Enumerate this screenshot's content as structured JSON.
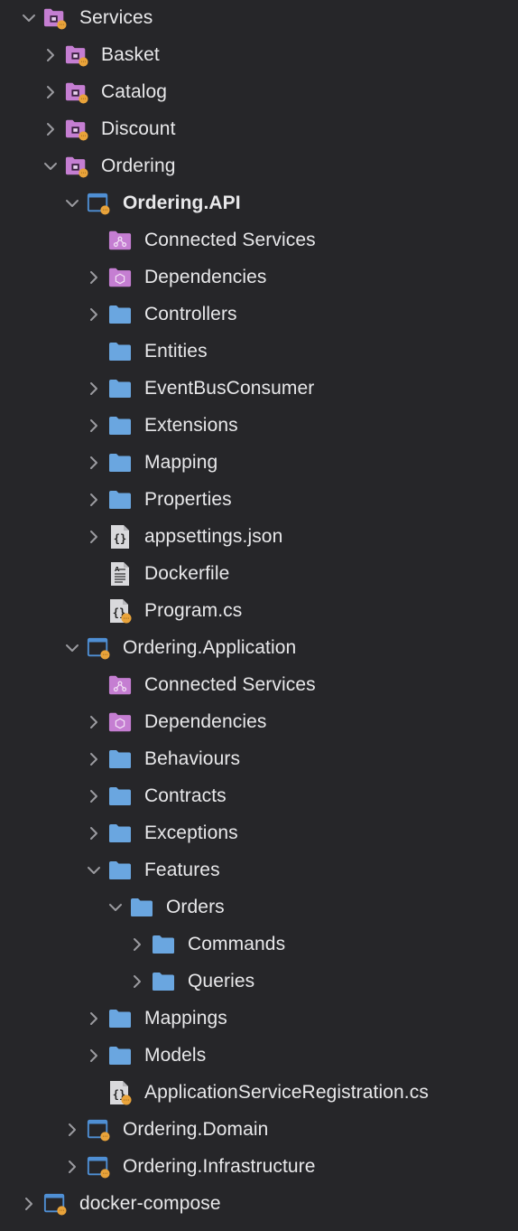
{
  "panel": "Solution Explorer",
  "nodes": [
    {
      "label": "Services",
      "depth": 0,
      "chevron": "down",
      "icon": "solution-folder-icon",
      "bold": false
    },
    {
      "label": "Basket",
      "depth": 1,
      "chevron": "right",
      "icon": "solution-folder-icon",
      "bold": false
    },
    {
      "label": "Catalog",
      "depth": 1,
      "chevron": "right",
      "icon": "solution-folder-icon",
      "bold": false
    },
    {
      "label": "Discount",
      "depth": 1,
      "chevron": "right",
      "icon": "solution-folder-icon",
      "bold": false
    },
    {
      "label": "Ordering",
      "depth": 1,
      "chevron": "down",
      "icon": "solution-folder-icon",
      "bold": false
    },
    {
      "label": "Ordering.API",
      "depth": 2,
      "chevron": "down",
      "icon": "project-icon",
      "bold": true
    },
    {
      "label": "Connected Services",
      "depth": 3,
      "chevron": "none",
      "icon": "connected-services-icon",
      "bold": false
    },
    {
      "label": "Dependencies",
      "depth": 3,
      "chevron": "right",
      "icon": "dependencies-icon",
      "bold": false
    },
    {
      "label": "Controllers",
      "depth": 3,
      "chevron": "right",
      "icon": "folder-icon",
      "bold": false
    },
    {
      "label": "Entities",
      "depth": 3,
      "chevron": "none",
      "icon": "folder-icon",
      "bold": false
    },
    {
      "label": "EventBusConsumer",
      "depth": 3,
      "chevron": "right",
      "icon": "folder-icon",
      "bold": false
    },
    {
      "label": "Extensions",
      "depth": 3,
      "chevron": "right",
      "icon": "folder-icon",
      "bold": false
    },
    {
      "label": "Mapping",
      "depth": 3,
      "chevron": "right",
      "icon": "folder-icon",
      "bold": false
    },
    {
      "label": "Properties",
      "depth": 3,
      "chevron": "right",
      "icon": "folder-icon",
      "bold": false
    },
    {
      "label": "appsettings.json",
      "depth": 3,
      "chevron": "right",
      "icon": "json-file-icon",
      "bold": false
    },
    {
      "label": "Dockerfile",
      "depth": 3,
      "chevron": "none",
      "icon": "text-file-icon",
      "bold": false
    },
    {
      "label": "Program.cs",
      "depth": 3,
      "chevron": "none",
      "icon": "csharp-file-icon",
      "bold": false
    },
    {
      "label": "Ordering.Application",
      "depth": 2,
      "chevron": "down",
      "icon": "project-icon",
      "bold": false
    },
    {
      "label": "Connected Services",
      "depth": 3,
      "chevron": "none",
      "icon": "connected-services-icon",
      "bold": false
    },
    {
      "label": "Dependencies",
      "depth": 3,
      "chevron": "right",
      "icon": "dependencies-icon",
      "bold": false
    },
    {
      "label": "Behaviours",
      "depth": 3,
      "chevron": "right",
      "icon": "folder-icon",
      "bold": false
    },
    {
      "label": "Contracts",
      "depth": 3,
      "chevron": "right",
      "icon": "folder-icon",
      "bold": false
    },
    {
      "label": "Exceptions",
      "depth": 3,
      "chevron": "right",
      "icon": "folder-icon",
      "bold": false
    },
    {
      "label": "Features",
      "depth": 3,
      "chevron": "down",
      "icon": "folder-icon",
      "bold": false
    },
    {
      "label": "Orders",
      "depth": 4,
      "chevron": "down",
      "icon": "folder-icon",
      "bold": false
    },
    {
      "label": "Commands",
      "depth": 5,
      "chevron": "right",
      "icon": "folder-icon",
      "bold": false
    },
    {
      "label": "Queries",
      "depth": 5,
      "chevron": "right",
      "icon": "folder-icon",
      "bold": false
    },
    {
      "label": "Mappings",
      "depth": 3,
      "chevron": "right",
      "icon": "folder-icon",
      "bold": false
    },
    {
      "label": "Models",
      "depth": 3,
      "chevron": "right",
      "icon": "folder-icon",
      "bold": false
    },
    {
      "label": "ApplicationServiceRegistration.cs",
      "depth": 3,
      "chevron": "none",
      "icon": "csharp-file-icon",
      "bold": false
    },
    {
      "label": "Ordering.Domain",
      "depth": 2,
      "chevron": "right",
      "icon": "project-icon",
      "bold": false
    },
    {
      "label": "Ordering.Infrastructure",
      "depth": 2,
      "chevron": "right",
      "icon": "project-icon",
      "bold": false
    },
    {
      "label": "docker-compose",
      "depth": 0,
      "chevron": "right",
      "icon": "project-icon",
      "bold": false
    }
  ],
  "colors": {
    "background": "#262629",
    "text": "#e8e8ea",
    "chevron": "#9b9ba0",
    "folder": "#6aa6e0",
    "solution_folder": "#c57ed2",
    "badge_orange": "#e9a33a",
    "project_frame": "#4f8fd4"
  }
}
